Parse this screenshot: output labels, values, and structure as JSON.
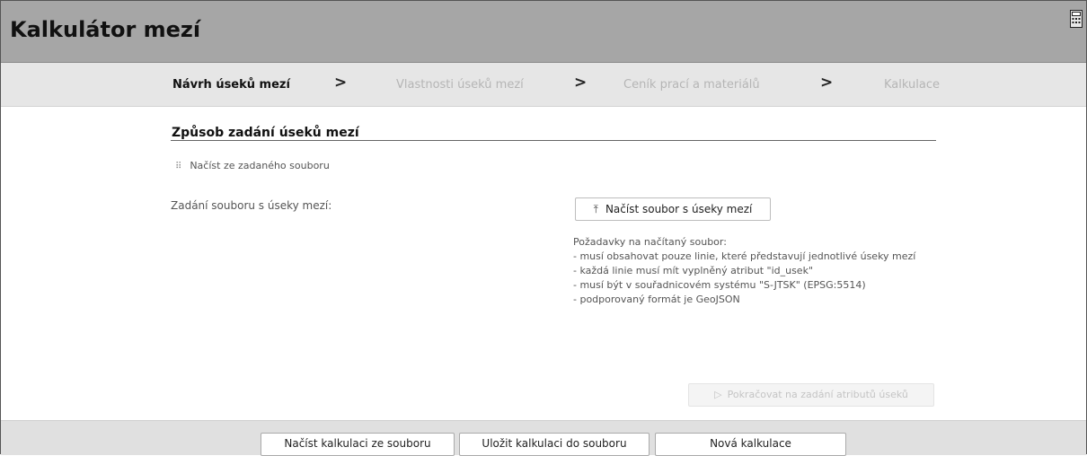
{
  "header": {
    "title": "Kalkulátor mezí",
    "icon": "calculator-icon"
  },
  "steps": [
    {
      "label": "Návrh úseků mezí",
      "state": "active"
    },
    {
      "label": "Vlastnosti úseků mezí",
      "state": "inactive"
    },
    {
      "label": "Ceník prací a materiálů",
      "state": "inactive"
    },
    {
      "label": "Kalkulace",
      "state": "inactive"
    }
  ],
  "step_separator": ">",
  "main": {
    "section_title": "Způsob zadání úseků mezí",
    "method_option": "Načíst ze zadaného souboru",
    "file_label": "Zadání souboru s úseky mezí:",
    "upload_button": "Načíst soubor s úseky mezí",
    "requirements": [
      "Požadavky na načítaný soubor:",
      "- musí obsahovat pouze linie, které představují jednotlivé úseky mezí",
      "- každá linie musí mít vyplněný atribut \"id_usek\"",
      "- musí být v souřadnicovém systému \"S-JTSK\" (EPSG:5514)",
      "- podporovaný formát je GeoJSON"
    ],
    "continue_button": "Pokračovat na zadání atributů úseků"
  },
  "footer": {
    "load_button": "Načíst kalkulaci ze souboru",
    "save_button": "Uložit kalkulaci do souboru",
    "new_button": "Nová kalkulace"
  },
  "colors": {
    "titlebar": "#a6a6a6",
    "stepbar": "#e6e6e6",
    "footer": "#e0e0e0"
  }
}
